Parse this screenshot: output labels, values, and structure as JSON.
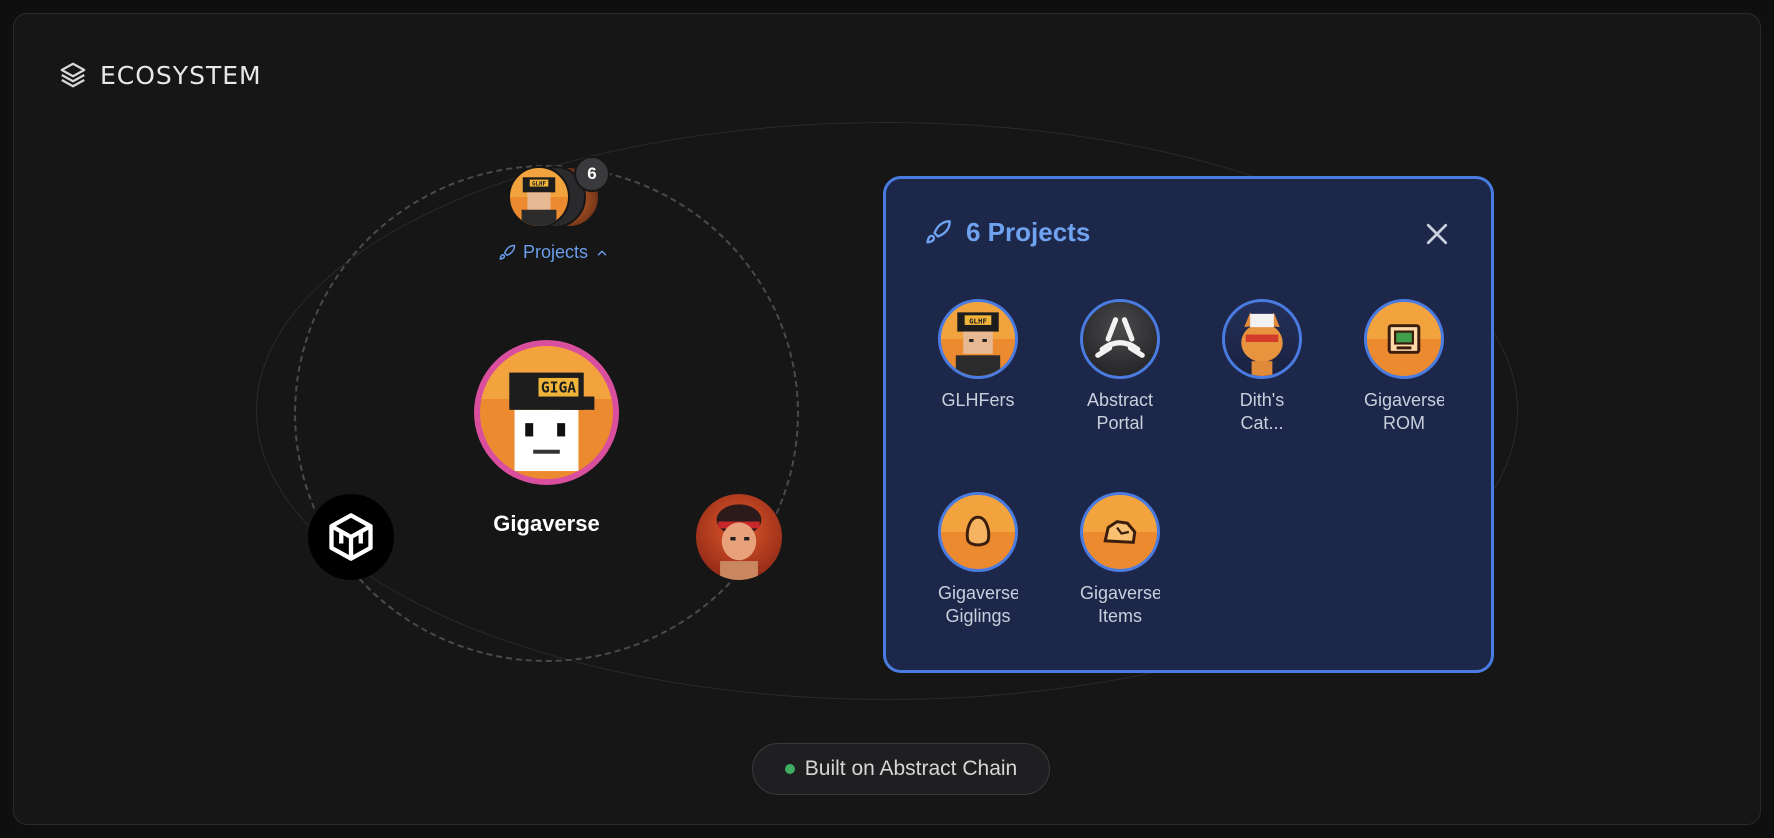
{
  "header": {
    "title": "ECOSYSTEM",
    "icon": "layers-icon"
  },
  "center": {
    "name": "Gigaverse",
    "cap_text": "GIGA",
    "ring_color": "#d94f9e"
  },
  "projects_stack": {
    "count": "6",
    "toggle_label": "Projects",
    "cap_text": "GLHF"
  },
  "popup": {
    "title": "6 Projects",
    "accent": "#4a7be0",
    "items": [
      {
        "label": "GLHFers",
        "cap_text": "GLHF"
      },
      {
        "label": "Abstract Portal"
      },
      {
        "label": "Dith's Cat..."
      },
      {
        "label": "Gigaverse ROM"
      },
      {
        "label": "Gigaverse Giglings"
      },
      {
        "label": "Gigaverse Items"
      }
    ]
  },
  "footer": {
    "label": "Built on Abstract Chain",
    "status_color": "#3fae63"
  }
}
